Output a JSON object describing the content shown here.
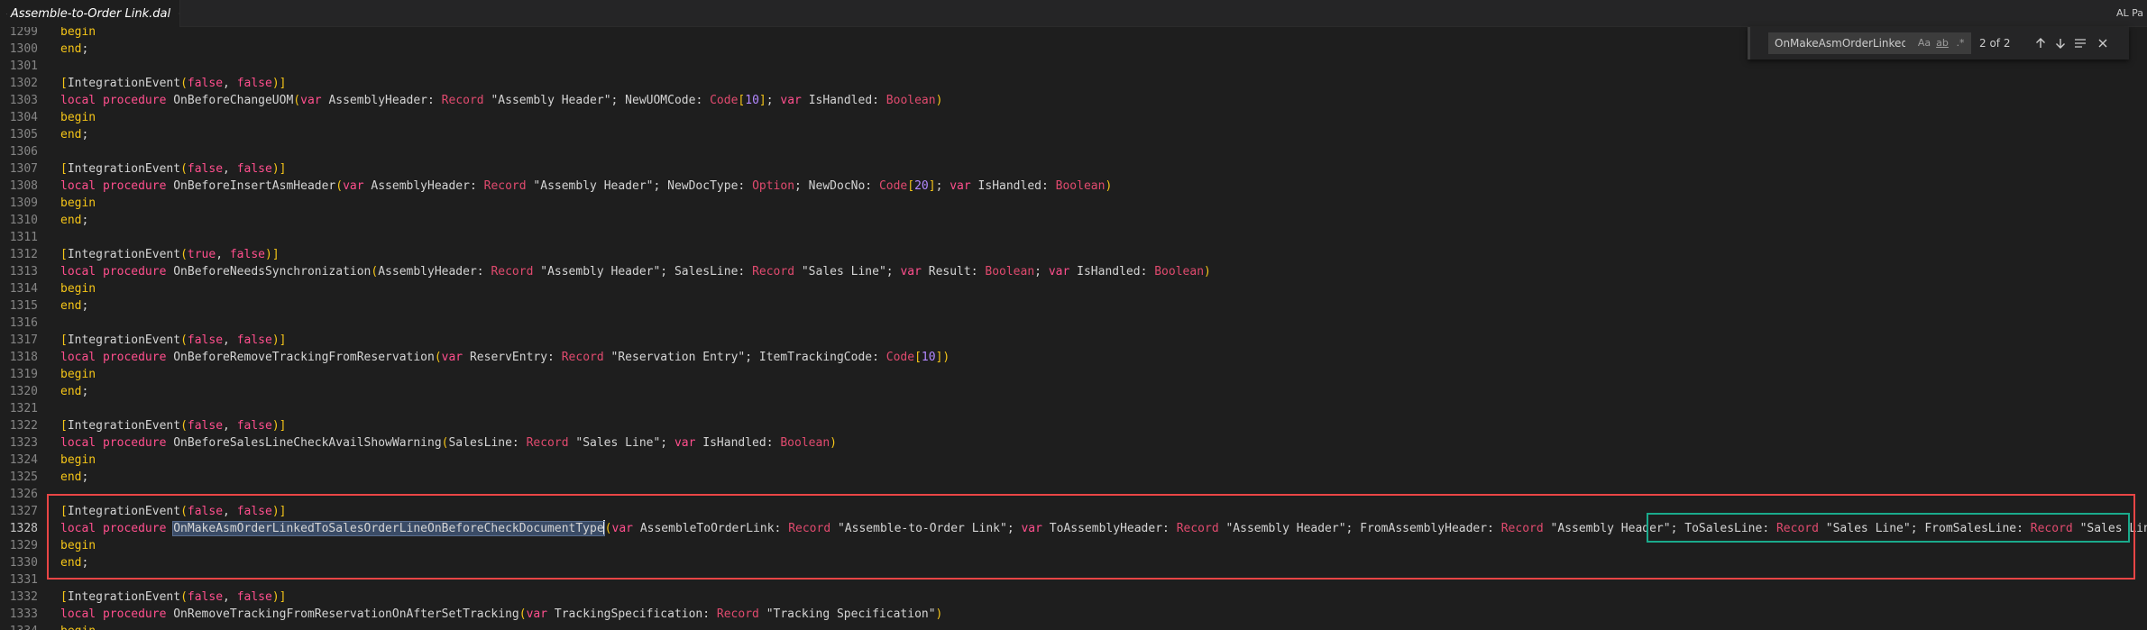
{
  "tab": {
    "title": "Assemble-to-Order Link.dal",
    "close_icon": "close-icon",
    "file_icon": "list-icon"
  },
  "top_right_label": "AL Pa",
  "find": {
    "query": "OnMakeAsmOrderLinkedTo",
    "match_case": "Aa",
    "whole_word": "ab",
    "regex": ".*",
    "count": "2 of 2"
  },
  "colors": {
    "keyword": "#ff4f8d",
    "begin_end": "#f5c518",
    "type": "#e04a6e",
    "number": "#b388ff",
    "highlight_red": "#e84545",
    "highlight_green": "#1aaa8c"
  },
  "active_line": "1328",
  "lines": [
    {
      "n": "1299",
      "t": [
        [
          "kw2",
          "begin"
        ]
      ]
    },
    {
      "n": "1300",
      "t": [
        [
          "kw2",
          "end"
        ],
        [
          "",
          "; "
        ]
      ]
    },
    {
      "n": "1301",
      "t": []
    },
    {
      "n": "1302",
      "t": [
        [
          "br",
          "["
        ],
        [
          "",
          "IntegrationEvent"
        ],
        [
          "br",
          "("
        ],
        [
          "kw",
          "false"
        ],
        [
          "",
          ", "
        ],
        [
          "kw",
          "false"
        ],
        [
          "br",
          ")"
        ],
        [
          "br",
          "]"
        ]
      ]
    },
    {
      "n": "1303",
      "t": [
        [
          "kw",
          "local procedure "
        ],
        [
          "",
          "OnBeforeChangeUOM"
        ],
        [
          "br",
          "("
        ],
        [
          "kw",
          "var "
        ],
        [
          "",
          "AssemblyHeader: "
        ],
        [
          "ty",
          "Record "
        ],
        [
          "",
          "\"Assembly Header\"; NewUOMCode: "
        ],
        [
          "ty",
          "Code"
        ],
        [
          "br",
          "["
        ],
        [
          "num",
          "10"
        ],
        [
          "br",
          "]"
        ],
        [
          "",
          "; "
        ],
        [
          "kw",
          "var "
        ],
        [
          "",
          "IsHandled: "
        ],
        [
          "ty",
          "Boolean"
        ],
        [
          "br",
          ")"
        ]
      ]
    },
    {
      "n": "1304",
      "t": [
        [
          "kw2",
          "begin"
        ]
      ]
    },
    {
      "n": "1305",
      "t": [
        [
          "kw2",
          "end"
        ],
        [
          "",
          "; "
        ]
      ]
    },
    {
      "n": "1306",
      "t": []
    },
    {
      "n": "1307",
      "t": [
        [
          "br",
          "["
        ],
        [
          "",
          "IntegrationEvent"
        ],
        [
          "br",
          "("
        ],
        [
          "kw",
          "false"
        ],
        [
          "",
          ", "
        ],
        [
          "kw",
          "false"
        ],
        [
          "br",
          ")"
        ],
        [
          "br",
          "]"
        ]
      ]
    },
    {
      "n": "1308",
      "t": [
        [
          "kw",
          "local procedure "
        ],
        [
          "",
          "OnBeforeInsertAsmHeader"
        ],
        [
          "br",
          "("
        ],
        [
          "kw",
          "var "
        ],
        [
          "",
          "AssemblyHeader: "
        ],
        [
          "ty",
          "Record "
        ],
        [
          "",
          "\"Assembly Header\"; NewDocType: "
        ],
        [
          "ty",
          "Option"
        ],
        [
          "",
          "; NewDocNo: "
        ],
        [
          "ty",
          "Code"
        ],
        [
          "br",
          "["
        ],
        [
          "num",
          "20"
        ],
        [
          "br",
          "]"
        ],
        [
          "",
          "; "
        ],
        [
          "kw",
          "var "
        ],
        [
          "",
          "IsHandled: "
        ],
        [
          "ty",
          "Boolean"
        ],
        [
          "br",
          ")"
        ]
      ]
    },
    {
      "n": "1309",
      "t": [
        [
          "kw2",
          "begin"
        ]
      ]
    },
    {
      "n": "1310",
      "t": [
        [
          "kw2",
          "end"
        ],
        [
          "",
          "; "
        ]
      ]
    },
    {
      "n": "1311",
      "t": []
    },
    {
      "n": "1312",
      "t": [
        [
          "br",
          "["
        ],
        [
          "",
          "IntegrationEvent"
        ],
        [
          "br",
          "("
        ],
        [
          "kw",
          "true"
        ],
        [
          "",
          ", "
        ],
        [
          "kw",
          "false"
        ],
        [
          "br",
          ")"
        ],
        [
          "br",
          "]"
        ]
      ]
    },
    {
      "n": "1313",
      "t": [
        [
          "kw",
          "local procedure "
        ],
        [
          "",
          "OnBeforeNeedsSynchronization"
        ],
        [
          "br",
          "("
        ],
        [
          "",
          "AssemblyHeader: "
        ],
        [
          "ty",
          "Record "
        ],
        [
          "",
          "\"Assembly Header\"; SalesLine: "
        ],
        [
          "ty",
          "Record "
        ],
        [
          "",
          "\"Sales Line\"; "
        ],
        [
          "kw",
          "var "
        ],
        [
          "",
          "Result: "
        ],
        [
          "ty",
          "Boolean"
        ],
        [
          "",
          "; "
        ],
        [
          "kw",
          "var "
        ],
        [
          "",
          "IsHandled: "
        ],
        [
          "ty",
          "Boolean"
        ],
        [
          "br",
          ")"
        ]
      ]
    },
    {
      "n": "1314",
      "t": [
        [
          "kw2",
          "begin"
        ]
      ]
    },
    {
      "n": "1315",
      "t": [
        [
          "kw2",
          "end"
        ],
        [
          "",
          "; "
        ]
      ]
    },
    {
      "n": "1316",
      "t": []
    },
    {
      "n": "1317",
      "t": [
        [
          "br",
          "["
        ],
        [
          "",
          "IntegrationEvent"
        ],
        [
          "br",
          "("
        ],
        [
          "kw",
          "false"
        ],
        [
          "",
          ", "
        ],
        [
          "kw",
          "false"
        ],
        [
          "br",
          ")"
        ],
        [
          "br",
          "]"
        ]
      ]
    },
    {
      "n": "1318",
      "t": [
        [
          "kw",
          "local procedure "
        ],
        [
          "",
          "OnBeforeRemoveTrackingFromReservation"
        ],
        [
          "br",
          "("
        ],
        [
          "kw",
          "var "
        ],
        [
          "",
          "ReservEntry: "
        ],
        [
          "ty",
          "Record "
        ],
        [
          "",
          "\"Reservation Entry\"; ItemTrackingCode: "
        ],
        [
          "ty",
          "Code"
        ],
        [
          "br",
          "["
        ],
        [
          "num",
          "10"
        ],
        [
          "br",
          "]"
        ],
        [
          "br",
          ")"
        ]
      ]
    },
    {
      "n": "1319",
      "t": [
        [
          "kw2",
          "begin"
        ]
      ]
    },
    {
      "n": "1320",
      "t": [
        [
          "kw2",
          "end"
        ],
        [
          "",
          "; "
        ]
      ]
    },
    {
      "n": "1321",
      "t": []
    },
    {
      "n": "1322",
      "t": [
        [
          "br",
          "["
        ],
        [
          "",
          "IntegrationEvent"
        ],
        [
          "br",
          "("
        ],
        [
          "kw",
          "false"
        ],
        [
          "",
          ", "
        ],
        [
          "kw",
          "false"
        ],
        [
          "br",
          ")"
        ],
        [
          "br",
          "]"
        ]
      ]
    },
    {
      "n": "1323",
      "t": [
        [
          "kw",
          "local procedure "
        ],
        [
          "",
          "OnBeforeSalesLineCheckAvailShowWarning"
        ],
        [
          "br",
          "("
        ],
        [
          "",
          "SalesLine: "
        ],
        [
          "ty",
          "Record "
        ],
        [
          "",
          "\"Sales Line\"; "
        ],
        [
          "kw",
          "var "
        ],
        [
          "",
          "IsHandled: "
        ],
        [
          "ty",
          "Boolean"
        ],
        [
          "br",
          ")"
        ]
      ]
    },
    {
      "n": "1324",
      "t": [
        [
          "kw2",
          "begin"
        ]
      ]
    },
    {
      "n": "1325",
      "t": [
        [
          "kw2",
          "end"
        ],
        [
          "",
          "; "
        ]
      ]
    },
    {
      "n": "1326",
      "t": []
    },
    {
      "n": "1327",
      "t": [
        [
          "br",
          "["
        ],
        [
          "",
          "IntegrationEvent"
        ],
        [
          "br",
          "("
        ],
        [
          "kw",
          "false"
        ],
        [
          "",
          ", "
        ],
        [
          "kw",
          "false"
        ],
        [
          "br",
          ")"
        ],
        [
          "br",
          "]"
        ]
      ]
    },
    {
      "n": "1328",
      "t": [
        [
          "kw",
          "local procedure "
        ],
        [
          "hl",
          "OnMakeAsmOrderLinkedToSalesOrderLineOnBeforeCheckDocumentType"
        ],
        [
          "cursor",
          ""
        ],
        [
          "br",
          "("
        ],
        [
          "kw",
          "var "
        ],
        [
          "",
          "AssembleToOrderLink: "
        ],
        [
          "ty",
          "Record "
        ],
        [
          "",
          "\"Assemble-to-Order Link\"; "
        ],
        [
          "kw",
          "var "
        ],
        [
          "",
          "ToAssemblyHeader: "
        ],
        [
          "ty",
          "Record "
        ],
        [
          "",
          "\"Assembly Header\"; FromAssemblyHeader: "
        ],
        [
          "ty",
          "Record "
        ],
        [
          "",
          "\"Assembly Header\"; ToSalesLine: "
        ],
        [
          "ty",
          "Record "
        ],
        [
          "",
          "\"Sales Line\"; FromSalesLine: "
        ],
        [
          "ty",
          "Record "
        ],
        [
          "",
          "\"Sales Line\""
        ],
        [
          "br",
          ")"
        ]
      ]
    },
    {
      "n": "1329",
      "t": [
        [
          "kw2",
          "begin"
        ]
      ]
    },
    {
      "n": "1330",
      "t": [
        [
          "kw2",
          "end"
        ],
        [
          "",
          "; "
        ]
      ]
    },
    {
      "n": "1331",
      "t": []
    },
    {
      "n": "1332",
      "t": [
        [
          "br",
          "["
        ],
        [
          "",
          "IntegrationEvent"
        ],
        [
          "br",
          "("
        ],
        [
          "kw",
          "false"
        ],
        [
          "",
          ", "
        ],
        [
          "kw",
          "false"
        ],
        [
          "br",
          ")"
        ],
        [
          "br",
          "]"
        ]
      ]
    },
    {
      "n": "1333",
      "t": [
        [
          "kw",
          "local procedure "
        ],
        [
          "",
          "OnRemoveTrackingFromReservationOnAfterSetTracking"
        ],
        [
          "br",
          "("
        ],
        [
          "kw",
          "var "
        ],
        [
          "",
          "TrackingSpecification: "
        ],
        [
          "ty",
          "Record "
        ],
        [
          "",
          "\"Tracking Specification\""
        ],
        [
          "br",
          ")"
        ]
      ]
    },
    {
      "n": "1334",
      "t": [
        [
          "kw2",
          "begin"
        ]
      ]
    }
  ]
}
